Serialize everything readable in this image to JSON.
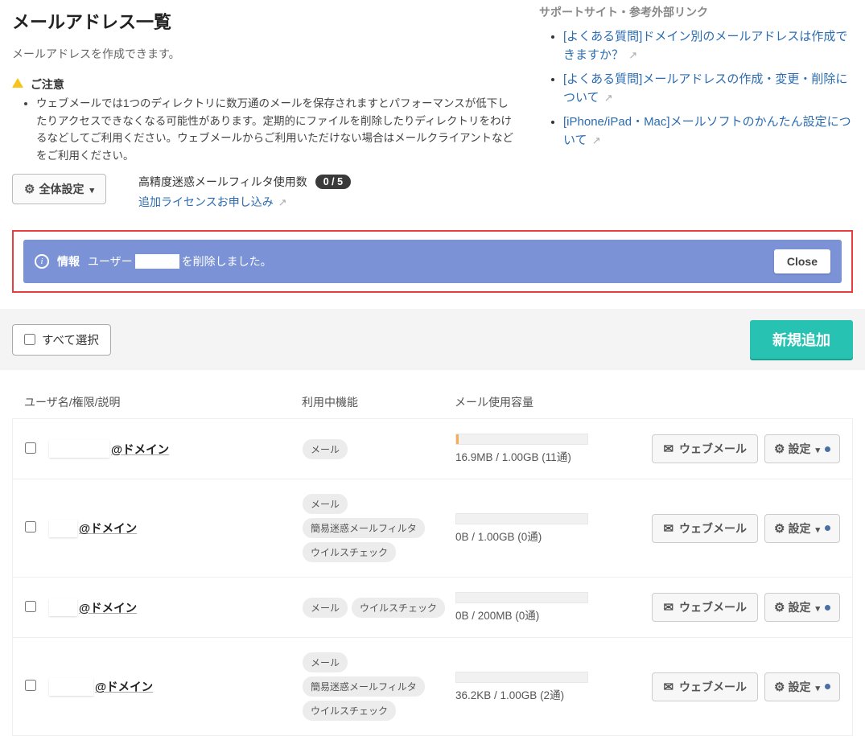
{
  "title": "メールアドレス一覧",
  "subtitle": "メールアドレスを作成できます。",
  "caution_head": "ご注意",
  "caution_item": "ウェブメールでは1つのディレクトリに数万通のメールを保存されますとパフォーマンスが低下したりアクセスできなくなる可能性があります。定期的にファイルを削除したりディレクトリをわけるなどしてご利用ください。ウェブメールからご利用いただけない場合はメールクライアントなどをご利用ください。",
  "sidebar_head": "サポートサイト・参考外部リンク",
  "links": [
    "[よくある質問]ドメイン別のメールアドレスは作成できますか？",
    "[よくある質問]メールアドレスの作成・変更・削除について",
    "[iPhone/iPad・Mac]メールソフトのかんたん設定について"
  ],
  "global_cfg_btn": "全体設定",
  "filter_count_label": "高精度迷惑メールフィルタ使用数",
  "filter_count_value": "0 / 5",
  "add_license_link": "追加ライセンスお申し込み",
  "alert_label": "情報",
  "alert_prefix": "ユーザー",
  "alert_suffix": "を削除しました。",
  "close_label": "Close",
  "select_all_label": "すべて選択",
  "new_add_label": "新規追加",
  "th_user": "ユーザ名/権限/説明",
  "th_func": "利用中機能",
  "th_usage": "メール使用容量",
  "webmail_label": "ウェブメール",
  "cfg_label": "設定",
  "rows": [
    {
      "domain": "@ドメイン",
      "chips": [
        "メール"
      ],
      "usage": "16.9MB / 1.00GB (11通)",
      "fill": 2,
      "space": 75
    },
    {
      "domain": "@ドメイン",
      "chips": [
        "メール",
        "簡易迷惑メールフィルタ",
        "ウイルスチェック"
      ],
      "usage": "0B / 1.00GB (0通)",
      "fill": 0,
      "space": 18
    },
    {
      "domain": "@ドメイン",
      "chips": [
        "メール",
        "ウイルスチェック"
      ],
      "usage": "0B / 200MB (0通)",
      "fill": 0,
      "space": 35
    },
    {
      "domain": "@ドメイン",
      "chips": [
        "メール",
        "簡易迷惑メールフィルタ",
        "ウイルスチェック"
      ],
      "usage": "36.2KB / 1.00GB (2通)",
      "fill": 0,
      "space": 55
    }
  ]
}
